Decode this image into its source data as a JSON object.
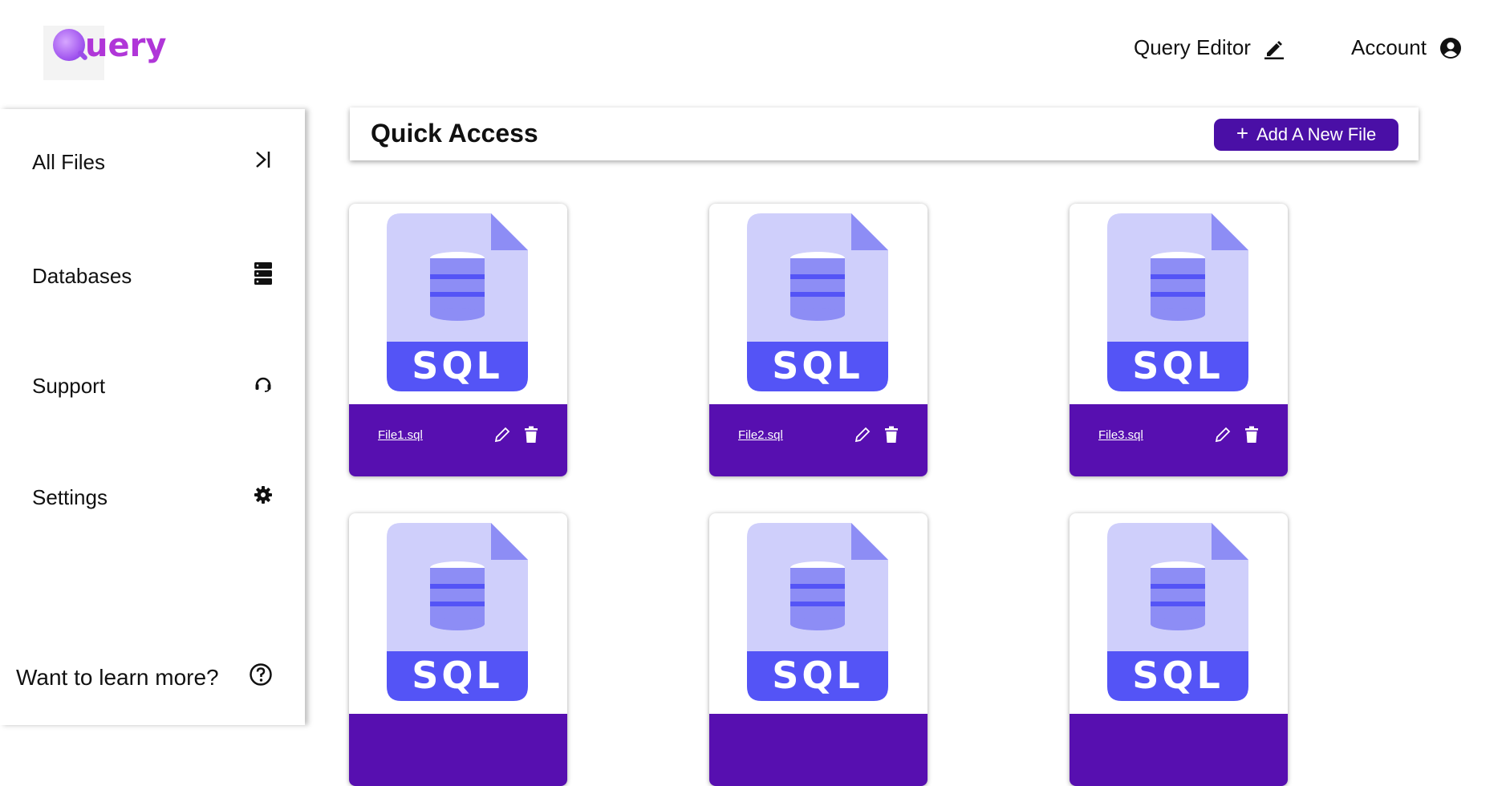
{
  "header": {
    "logo_text": "uery",
    "nav": [
      {
        "label": "Query Editor",
        "icon": "pencil-icon"
      },
      {
        "label": "Account",
        "icon": "user-circle-icon"
      }
    ]
  },
  "sidebar": {
    "items": [
      {
        "label": "All Files",
        "icon": "collapse-arrow-icon"
      },
      {
        "label": "Databases",
        "icon": "server-icon"
      },
      {
        "label": "Support",
        "icon": "headset-icon"
      },
      {
        "label": "Settings",
        "icon": "gear-icon"
      }
    ],
    "learn_more": {
      "label": "Want to learn more?",
      "icon": "question-circle-icon"
    }
  },
  "quick_access": {
    "title": "Quick Access",
    "add_button": {
      "label": "Add A New File",
      "icon": "plus-icon"
    }
  },
  "files": [
    {
      "name": "File1.sql",
      "thumb_label": "SQL"
    },
    {
      "name": "File2.sql",
      "thumb_label": "SQL"
    },
    {
      "name": "File3.sql",
      "thumb_label": "SQL"
    },
    {
      "name": "",
      "thumb_label": "SQL"
    },
    {
      "name": "",
      "thumb_label": "SQL"
    },
    {
      "name": "",
      "thumb_label": "SQL"
    }
  ],
  "colors": {
    "accent": "#570fb0",
    "button": "#4a0fa6",
    "file_icon_light": "#cfcffb",
    "file_icon_dark": "#5454f6",
    "logo": "#b036d8"
  }
}
